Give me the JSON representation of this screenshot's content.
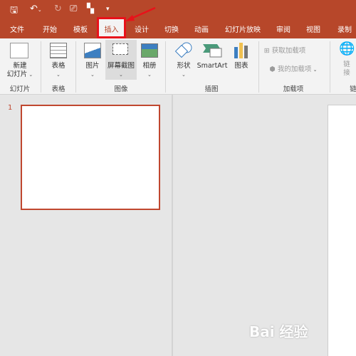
{
  "quick_access": {
    "icons": [
      "save-icon",
      "undo-icon",
      "redo-icon",
      "present-icon",
      "layout-icon",
      "customize-icon"
    ]
  },
  "tabs": [
    "文件",
    "开始",
    "模板",
    "插入",
    "设计",
    "切换",
    "动画",
    "幻灯片放映",
    "审阅",
    "视图",
    "录制"
  ],
  "active_tab": "插入",
  "ribbon": {
    "new_slide": [
      "新建",
      "幻灯片"
    ],
    "table": "表格",
    "picture": "图片",
    "screenshot": "屏幕截图",
    "album": "相册",
    "shapes": "形状",
    "smartart": "SmartArt",
    "chart": "图表",
    "get_addins": "获取加载项",
    "my_addins": "我的加载项",
    "link": [
      "链",
      "接"
    ],
    "groups": [
      "幻灯片",
      "表格",
      "图像",
      "插图",
      "加载项",
      "链"
    ]
  },
  "slides_pane": {
    "slide_number": "1"
  },
  "colors": {
    "accent": "#b7472a",
    "highlight_box": "#e8121a"
  },
  "watermark": "Bai 经验"
}
